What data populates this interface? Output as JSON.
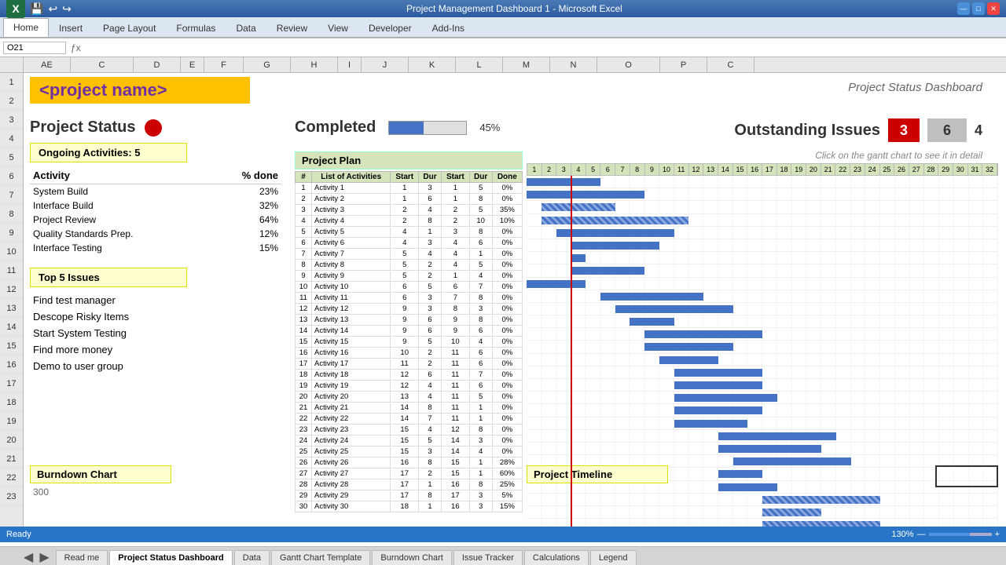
{
  "titlebar": {
    "title": "Project Management Dashboard 1 - Microsoft Excel",
    "buttons": {
      "minimize": "—",
      "maximize": "□",
      "close": "✕"
    }
  },
  "ribbon": {
    "tabs": [
      "Home",
      "Insert",
      "Page Layout",
      "Formulas",
      "Data",
      "Review",
      "View",
      "Developer",
      "Add-Ins"
    ],
    "active_tab": "Home"
  },
  "formula_bar": {
    "cell_ref": "O21",
    "formula": ""
  },
  "columns": [
    "AE",
    "C",
    "D",
    "E",
    "F",
    "G",
    "H",
    "I",
    "J",
    "K",
    "L",
    "M",
    "N",
    "O",
    "P",
    "C"
  ],
  "rows": [
    "1",
    "2",
    "3",
    "4",
    "5",
    "6",
    "7",
    "8",
    "9",
    "10",
    "11",
    "12",
    "13",
    "14",
    "15",
    "16",
    "17",
    "18",
    "19",
    "20",
    "21",
    "22",
    "23"
  ],
  "project_name": "<project name>",
  "dashboard_title": "Project Status Dashboard",
  "project_status": {
    "title": "Project Status",
    "status_color": "red",
    "ongoing_activities": "Ongoing Activities: 5",
    "activity_header": "Activity",
    "pct_done_header": "% done",
    "activities": [
      {
        "name": "System Build",
        "pct": "23%"
      },
      {
        "name": "Interface Build",
        "pct": "32%"
      },
      {
        "name": "Project Review",
        "pct": "64%"
      },
      {
        "name": "Quality Standards Prep.",
        "pct": "12%"
      },
      {
        "name": "Interface Testing",
        "pct": "15%"
      }
    ],
    "top_issues_label": "Top 5 Issues",
    "issues": [
      "Find test manager",
      "Descope Risky Items",
      "Start System Testing",
      "Find more money",
      "Demo to user group"
    ]
  },
  "completed": {
    "label": "Completed",
    "progress_pct": 45,
    "display_pct": "45%"
  },
  "outstanding_issues": {
    "title": "Outstanding Issues",
    "red_count": "3",
    "gray_count": "6",
    "white_count": "4",
    "hint": "Click on the gantt chart to see it in detail"
  },
  "project_plan": {
    "header": "Project Plan",
    "columns": [
      "#",
      "List of Activities",
      "Start",
      "Dur",
      "Start",
      "Dur",
      "Done"
    ],
    "gantt_cols": [
      "1",
      "2",
      "3",
      "4",
      "5",
      "6",
      "7",
      "8",
      "9",
      "10",
      "11",
      "12",
      "13",
      "14",
      "15",
      "16",
      "17",
      "18",
      "19",
      "20",
      "21",
      "22",
      "23",
      "24",
      "25",
      "26",
      "27",
      "28",
      "29",
      "30",
      "31",
      "32"
    ],
    "activities": [
      {
        "num": "1",
        "name": "Activity 1",
        "s1": "1",
        "d1": "3",
        "s2": "1",
        "d2": "5",
        "done": "0%"
      },
      {
        "num": "2",
        "name": "Activity 2",
        "s1": "1",
        "d1": "6",
        "s2": "1",
        "d2": "8",
        "done": "0%"
      },
      {
        "num": "3",
        "name": "Activity 3",
        "s1": "2",
        "d1": "4",
        "s2": "2",
        "d2": "5",
        "done": "35%"
      },
      {
        "num": "4",
        "name": "Activity 4",
        "s1": "2",
        "d1": "8",
        "s2": "2",
        "d2": "10",
        "done": "10%"
      },
      {
        "num": "5",
        "name": "Activity 5",
        "s1": "4",
        "d1": "1",
        "s2": "3",
        "d2": "8",
        "done": "0%"
      },
      {
        "num": "6",
        "name": "Activity 6",
        "s1": "4",
        "d1": "3",
        "s2": "4",
        "d2": "6",
        "done": "0%"
      },
      {
        "num": "7",
        "name": "Activity 7",
        "s1": "5",
        "d1": "4",
        "s2": "4",
        "d2": "1",
        "done": "0%"
      },
      {
        "num": "8",
        "name": "Activity 8",
        "s1": "5",
        "d1": "2",
        "s2": "4",
        "d2": "5",
        "done": "0%"
      },
      {
        "num": "9",
        "name": "Activity 9",
        "s1": "5",
        "d1": "2",
        "s2": "1",
        "d2": "4",
        "done": "0%"
      },
      {
        "num": "10",
        "name": "Activity 10",
        "s1": "6",
        "d1": "5",
        "s2": "6",
        "d2": "7",
        "done": "0%"
      },
      {
        "num": "11",
        "name": "Activity 11",
        "s1": "6",
        "d1": "3",
        "s2": "7",
        "d2": "8",
        "done": "0%"
      },
      {
        "num": "12",
        "name": "Activity 12",
        "s1": "9",
        "d1": "3",
        "s2": "8",
        "d2": "3",
        "done": "0%"
      },
      {
        "num": "13",
        "name": "Activity 13",
        "s1": "9",
        "d1": "6",
        "s2": "9",
        "d2": "8",
        "done": "0%"
      },
      {
        "num": "14",
        "name": "Activity 14",
        "s1": "9",
        "d1": "6",
        "s2": "9",
        "d2": "6",
        "done": "0%"
      },
      {
        "num": "15",
        "name": "Activity 15",
        "s1": "9",
        "d1": "5",
        "s2": "10",
        "d2": "4",
        "done": "0%"
      },
      {
        "num": "16",
        "name": "Activity 16",
        "s1": "10",
        "d1": "2",
        "s2": "11",
        "d2": "6",
        "done": "0%"
      },
      {
        "num": "17",
        "name": "Activity 17",
        "s1": "11",
        "d1": "2",
        "s2": "11",
        "d2": "6",
        "done": "0%"
      },
      {
        "num": "18",
        "name": "Activity 18",
        "s1": "12",
        "d1": "6",
        "s2": "11",
        "d2": "7",
        "done": "0%"
      },
      {
        "num": "19",
        "name": "Activity 19",
        "s1": "12",
        "d1": "4",
        "s2": "11",
        "d2": "6",
        "done": "0%"
      },
      {
        "num": "20",
        "name": "Activity 20",
        "s1": "13",
        "d1": "4",
        "s2": "11",
        "d2": "5",
        "done": "0%"
      },
      {
        "num": "21",
        "name": "Activity 21",
        "s1": "14",
        "d1": "8",
        "s2": "11",
        "d2": "1",
        "done": "0%"
      },
      {
        "num": "22",
        "name": "Activity 22",
        "s1": "14",
        "d1": "7",
        "s2": "11",
        "d2": "1",
        "done": "0%"
      },
      {
        "num": "23",
        "name": "Activity 23",
        "s1": "15",
        "d1": "4",
        "s2": "12",
        "d2": "8",
        "done": "0%"
      },
      {
        "num": "24",
        "name": "Activity 24",
        "s1": "15",
        "d1": "5",
        "s2": "14",
        "d2": "3",
        "done": "0%"
      },
      {
        "num": "25",
        "name": "Activity 25",
        "s1": "15",
        "d1": "3",
        "s2": "14",
        "d2": "4",
        "done": "0%"
      },
      {
        "num": "26",
        "name": "Activity 26",
        "s1": "16",
        "d1": "8",
        "s2": "15",
        "d2": "1",
        "done": "28%"
      },
      {
        "num": "27",
        "name": "Activity 27",
        "s1": "17",
        "d1": "2",
        "s2": "15",
        "d2": "1",
        "done": "60%"
      },
      {
        "num": "28",
        "name": "Activity 28",
        "s1": "17",
        "d1": "1",
        "s2": "16",
        "d2": "8",
        "done": "25%"
      },
      {
        "num": "29",
        "name": "Activity 29",
        "s1": "17",
        "d1": "8",
        "s2": "17",
        "d2": "3",
        "done": "5%"
      },
      {
        "num": "30",
        "name": "Activity 30",
        "s1": "18",
        "d1": "1",
        "s2": "16",
        "d2": "3",
        "done": "15%"
      }
    ]
  },
  "burndown": {
    "title": "Burndown Chart",
    "value": "300"
  },
  "project_timeline": {
    "title": "Project Timeline"
  },
  "sheet_tabs": [
    "Read me",
    "Project Status Dashboard",
    "Data",
    "Gantt Chart Template",
    "Burndown Chart",
    "Issue Tracker",
    "Calculations",
    "Legend"
  ],
  "active_sheet": "Project Status Dashboard",
  "status_bar": {
    "mode": "Ready",
    "zoom": "130%"
  }
}
